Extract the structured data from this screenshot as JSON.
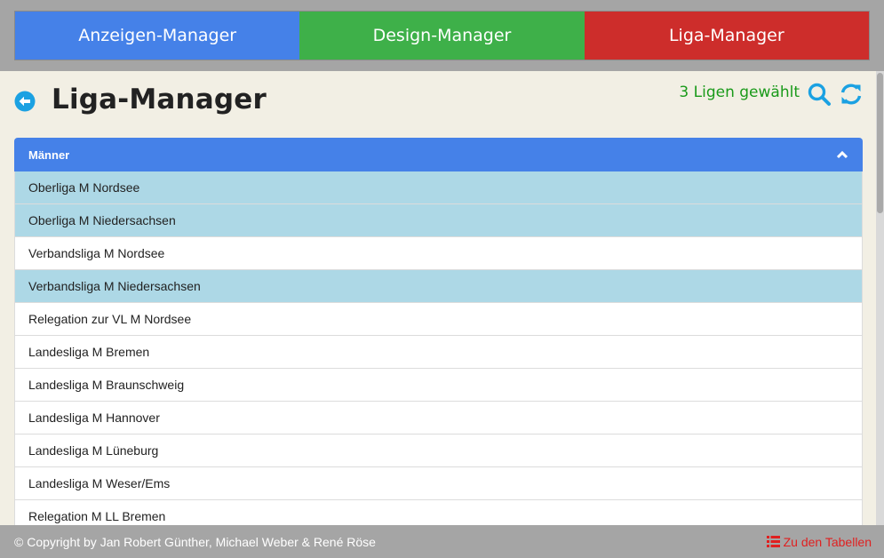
{
  "colors": {
    "tab_ads": "#4581e8",
    "tab_design": "#3eb049",
    "tab_league": "#cd2d2b",
    "panel_header": "#4581e8",
    "selected_row": "#add8e6",
    "unselected_row": "#ffffff",
    "accent": "#1ba1e2",
    "selected_count": "#1a9a1a",
    "link_red": "#e02020"
  },
  "nav": {
    "tabs": [
      {
        "label": "Anzeigen-Manager",
        "active": false
      },
      {
        "label": "Design-Manager",
        "active": false
      },
      {
        "label": "Liga-Manager",
        "active": true
      }
    ]
  },
  "header": {
    "back_icon": "arrow-circle-left-icon",
    "title": "Liga-Manager",
    "selected_count": "3 Ligen gewählt",
    "search_icon": "search-icon",
    "refresh_icon": "refresh-icon"
  },
  "panel": {
    "title": "Männer",
    "expanded": true,
    "toggle_icon": "chevron-up-icon",
    "leagues": [
      {
        "name": "Oberliga M Nordsee",
        "selected": true
      },
      {
        "name": "Oberliga M Niedersachsen",
        "selected": true
      },
      {
        "name": "Verbandsliga M Nordsee",
        "selected": false
      },
      {
        "name": "Verbandsliga M Niedersachsen",
        "selected": true
      },
      {
        "name": "Relegation zur VL M Nordsee",
        "selected": false
      },
      {
        "name": "Landesliga M Bremen",
        "selected": false
      },
      {
        "name": "Landesliga M Braunschweig",
        "selected": false
      },
      {
        "name": "Landesliga M Hannover",
        "selected": false
      },
      {
        "name": "Landesliga M Lüneburg",
        "selected": false
      },
      {
        "name": "Landesliga M Weser/Ems",
        "selected": false
      },
      {
        "name": "Relegation M LL Bremen",
        "selected": false
      }
    ]
  },
  "footer": {
    "copyright": "© Copyright by Jan Robert Günther, Michael Weber & René Röse",
    "tables_link": "Zu den Tabellen",
    "tables_icon": "list-icon"
  }
}
